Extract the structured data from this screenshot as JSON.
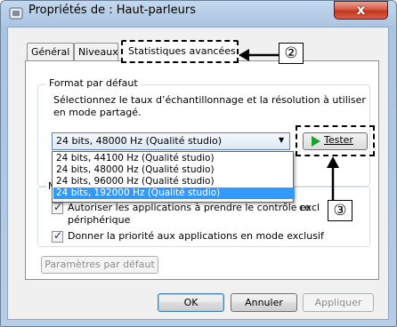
{
  "window": {
    "title": "Propriétés de : Haut-parleurs",
    "close_label": "x"
  },
  "tabs": [
    {
      "label": "Général"
    },
    {
      "label": "Niveaux"
    },
    {
      "label": "Statistiques avancées"
    }
  ],
  "default_format": {
    "group_title": "Format par défaut",
    "description": "Sélectionnez le taux d’échantillonnage et la résolution à utiliser en mode partagé.",
    "selected": "24 bits, 48000 Hz (Qualité studio)",
    "test_button": "Tester",
    "options": [
      "24 bits, 44100 Hz (Qualité studio)",
      "24 bits, 48000 Hz (Qualité studio)",
      "24 bits, 96000 Hz (Qualité studio)",
      "24 bits, 192000 Hz (Qualité studio)"
    ],
    "highlighted_option_index": 3
  },
  "exclusive_mode": {
    "group_title_stub": "M",
    "checkbox1_label_partial": "Autoriser les applications à prendre le contrôle excl",
    "checkbox1_tail": "ce",
    "checkbox1_label_line2": "périphérique",
    "checkbox2_label": "Donner la priorité aux applications en mode exclusif",
    "checkbox1_checked": true,
    "checkbox2_checked": true
  },
  "defaults_button": "Paramètres par défaut",
  "buttons": {
    "ok": "OK",
    "cancel": "Annuler",
    "apply": "Appliquer"
  },
  "callouts": {
    "two": "②",
    "three": "③"
  },
  "colors": {
    "selection": "#3399ff",
    "play": "#18a330",
    "close": "#c2331c"
  }
}
